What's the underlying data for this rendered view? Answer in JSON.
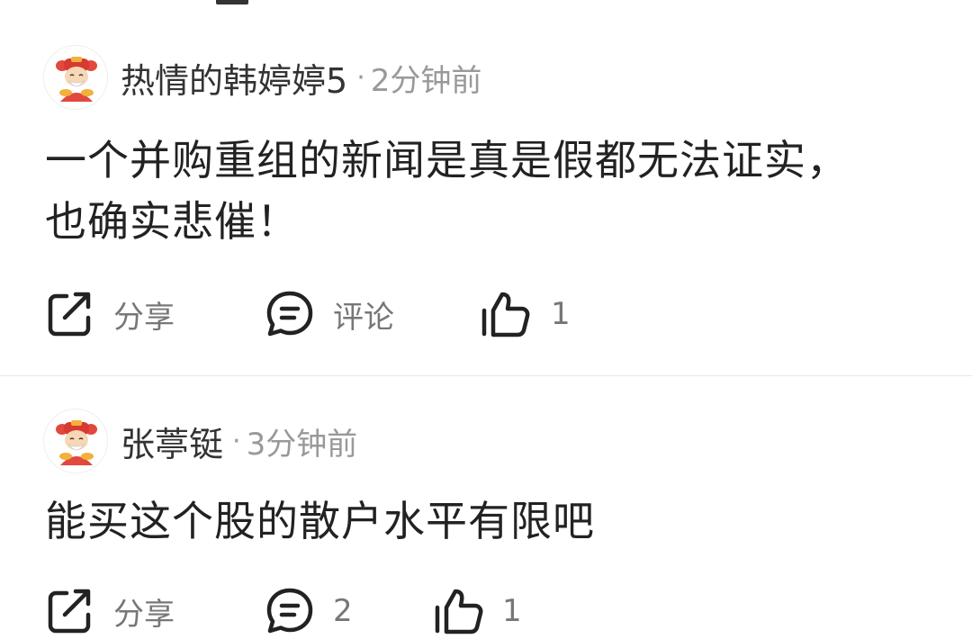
{
  "comments": [
    {
      "username": "热情的韩婷婷5",
      "time": "2分钟前",
      "text_line1": "一个并购重组的新闻是真是假都无法证实，",
      "text_line2": "也确实悲催！",
      "share_label": "分享",
      "comment_label": "评论",
      "like_count": "1"
    },
    {
      "username": "张葶铤",
      "time": "3分钟前",
      "text_line1": "能买这个股的散户水平有限吧",
      "share_label": "分享",
      "comment_count": "2",
      "like_count": "1"
    }
  ],
  "separator": "·",
  "icons": {
    "share": "share-icon",
    "comment": "comment-icon",
    "like": "thumbs-up-icon",
    "avatar": "fortune-god-avatar"
  }
}
